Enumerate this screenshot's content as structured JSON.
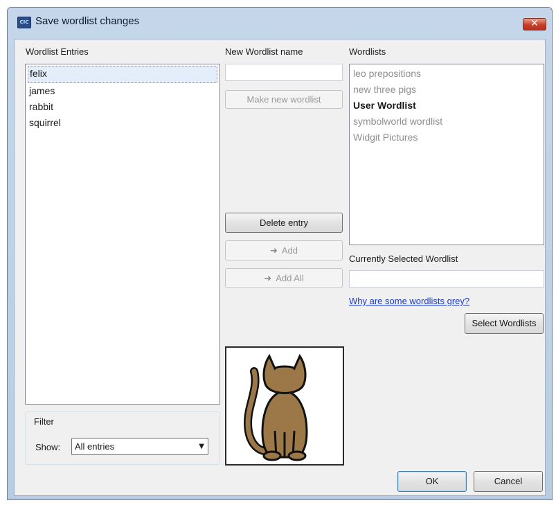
{
  "window": {
    "title": "Save wordlist changes",
    "icon": "app-icon",
    "icon_text": "CIC",
    "close_glyph": "✕"
  },
  "entries": {
    "label": "Wordlist Entries",
    "items": [
      {
        "label": "felix",
        "selected": true
      },
      {
        "label": "james",
        "selected": false
      },
      {
        "label": "rabbit",
        "selected": false
      },
      {
        "label": "squirrel",
        "selected": false
      }
    ]
  },
  "new_wordlist": {
    "label": "New Wordlist name",
    "value": "",
    "make_button": "Make new wordlist"
  },
  "actions": {
    "delete_entry": "Delete entry",
    "add": "Add",
    "add_all": "Add All",
    "arrow_icon": "➜"
  },
  "wordlists": {
    "label": "Wordlists",
    "items": [
      {
        "label": "leo prepositions",
        "state": "grey"
      },
      {
        "label": "new three pigs",
        "state": "grey"
      },
      {
        "label": "User Wordlist",
        "state": "bold"
      },
      {
        "label": "symbolworld wordlist",
        "state": "grey"
      },
      {
        "label": "Widgit Pictures",
        "state": "grey"
      }
    ]
  },
  "current": {
    "label": "Currently Selected Wordlist",
    "value": ""
  },
  "help_link": "Why are some wordlists grey?",
  "select_wordlists": "Select Wordlists",
  "filter": {
    "label": "Filter",
    "show_label": "Show:",
    "selected": "All entries"
  },
  "preview": {
    "symbol": "cat-symbol",
    "fill_color": "#9c7748",
    "outline_color": "#111111"
  },
  "footer": {
    "ok": "OK",
    "cancel": "Cancel"
  }
}
